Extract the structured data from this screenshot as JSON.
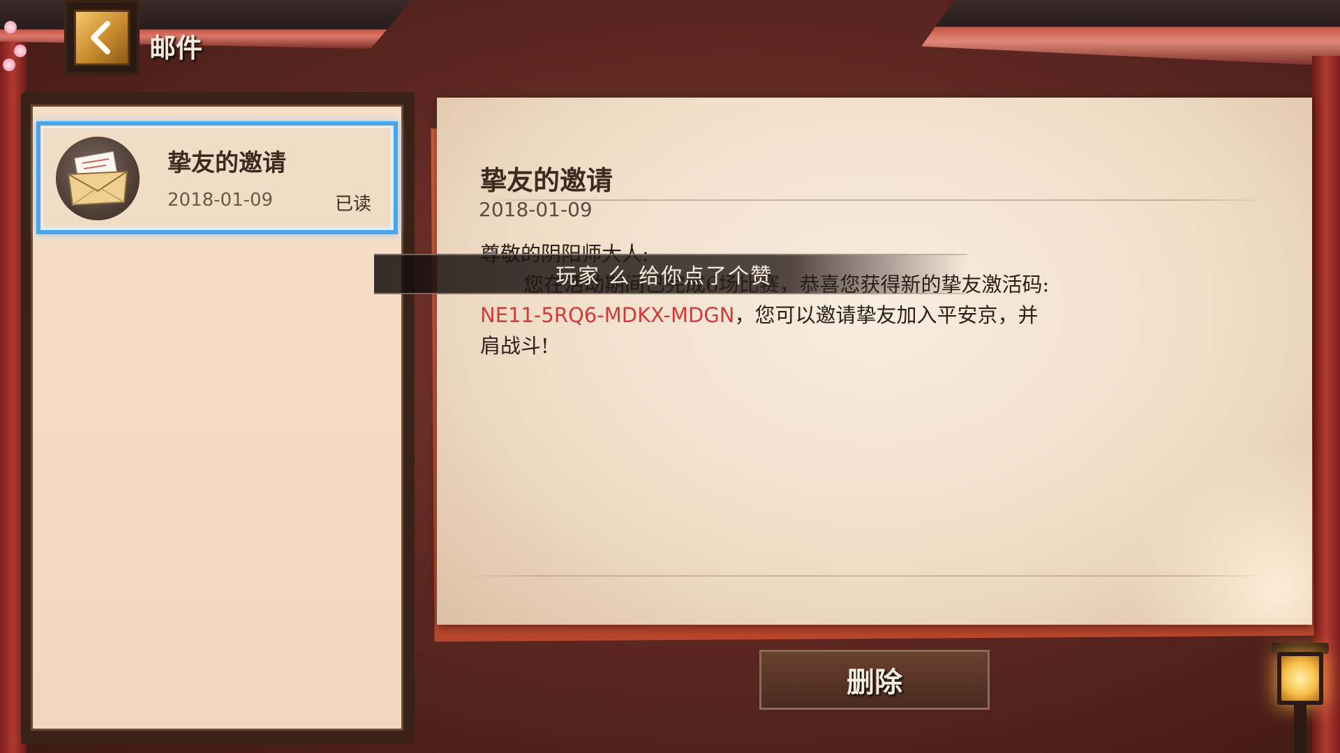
{
  "header": {
    "title": "邮件",
    "back_icon": "chevron-left-icon"
  },
  "mail_list": {
    "items": [
      {
        "title": "挚友的邀请",
        "date": "2018-01-09",
        "status": "已读",
        "icon": "envelope-icon",
        "selected": true
      }
    ]
  },
  "mail_detail": {
    "title": "挚友的邀请",
    "date": "2018-01-09",
    "greeting": "尊敬的阴阳师大人:",
    "line1": "您在活动期间已完成6场比赛，恭喜您获得新的挚友激活码:",
    "code": "NE11-5RQ6-MDKX-MDGN",
    "line2_after_code": "，您可以邀请挚友加入平安京，并",
    "line3": "肩战斗!"
  },
  "toast": {
    "text": "玩家 么 给你点了个赞"
  },
  "actions": {
    "delete_label": "删除"
  },
  "colors": {
    "code_red": "#d23a3a",
    "selection_blue": "#4aa6ea",
    "paper": "#f2e2cf",
    "background": "#5b2620"
  }
}
